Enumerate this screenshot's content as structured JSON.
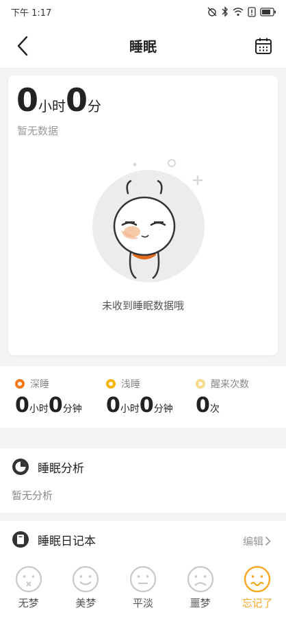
{
  "status_bar": {
    "time": "下午 1:17"
  },
  "header": {
    "title": "睡眠"
  },
  "summary": {
    "hours": "0",
    "hours_unit": "小时",
    "minutes": "0",
    "minutes_unit": "分",
    "no_data": "暂无数据",
    "empty_message": "未收到睡眠数据哦"
  },
  "stats": [
    {
      "label": "深睡",
      "color": "#f07a1a",
      "hours": "0",
      "hours_unit": "小时",
      "minutes": "0",
      "minutes_unit": "分钟"
    },
    {
      "label": "浅睡",
      "color": "#f5b400",
      "hours": "0",
      "hours_unit": "小时",
      "minutes": "0",
      "minutes_unit": "分钟"
    },
    {
      "label": "醒来次数",
      "color": "#f8dc8a",
      "count": "0",
      "count_unit": "次"
    }
  ],
  "analysis": {
    "title": "睡眠分析",
    "empty": "暂无分析"
  },
  "diary": {
    "title": "睡眠日记本",
    "edit_label": "编辑",
    "moods": [
      {
        "label": "无梦",
        "icon": "no-dream-face-icon"
      },
      {
        "label": "美梦",
        "icon": "sweet-dream-face-icon"
      },
      {
        "label": "平淡",
        "icon": "neutral-face-icon"
      },
      {
        "label": "噩梦",
        "icon": "nightmare-face-icon"
      },
      {
        "label": "忘记了",
        "icon": "forgot-face-icon",
        "selected": true
      }
    ]
  },
  "colors": {
    "accent": "#f5a623",
    "deep_sleep": "#f07a1a",
    "light_sleep": "#f5b400",
    "wake": "#f8dc8a"
  }
}
